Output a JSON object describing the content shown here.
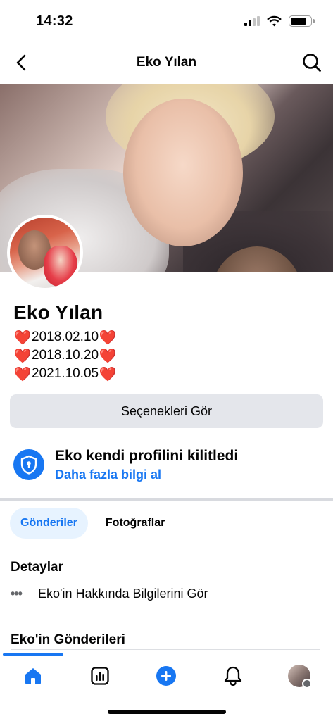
{
  "status_bar": {
    "time": "14:32"
  },
  "header": {
    "title": "Eko Yılan"
  },
  "profile": {
    "name": "Eko Yılan",
    "bio": [
      {
        "heart": "❤️",
        "date": "2018.02.10"
      },
      {
        "heart": "❤️",
        "date": "2018.10.20"
      },
      {
        "heart": "❤️",
        "date": "2021.10.05"
      }
    ]
  },
  "actions": {
    "options_label": "Seçenekleri Gör"
  },
  "lock_notice": {
    "title": "Eko kendi profilini kilitledi",
    "link": "Daha fazla bilgi al"
  },
  "tabs": [
    {
      "label": "Gönderiler",
      "active": true
    },
    {
      "label": "Fotoğraflar",
      "active": false
    }
  ],
  "details": {
    "title": "Detaylar",
    "about_link": "Eko'in Hakkında Bilgilerini Gör"
  },
  "posts": {
    "title": "Eko'in Gönderileri"
  },
  "colors": {
    "accent": "#1877f2",
    "button_bg": "#e4e6eb",
    "heart": "#e0132a"
  },
  "bottom_nav": {
    "items": [
      "home-icon",
      "feed-chart-icon",
      "add-icon",
      "bell-icon",
      "profile-avatar"
    ]
  }
}
